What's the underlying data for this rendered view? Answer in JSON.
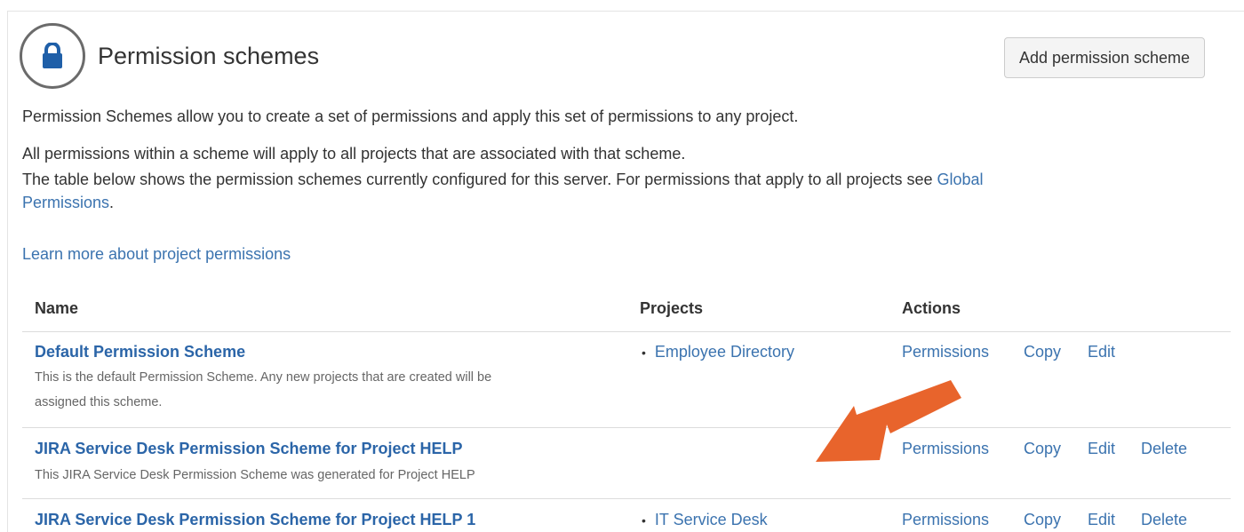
{
  "header": {
    "title": "Permission schemes",
    "add_button": "Add permission scheme"
  },
  "intro": {
    "line1": "Permission Schemes allow you to create a set of permissions and apply this set of permissions to any project.",
    "line2": "All permissions within a scheme will apply to all projects that are associated with that scheme.",
    "line3a": "The table below shows the permission schemes currently configured for this server. For permissions that apply to all projects see ",
    "line3_link1": "Global",
    "line3_link2": "Permissions",
    "line3_end": ".",
    "learn_more": "Learn more about project permissions"
  },
  "table": {
    "headers": {
      "name": "Name",
      "projects": "Projects",
      "actions": "Actions"
    },
    "rows": [
      {
        "name": "Default Permission Scheme",
        "desc1": "This is the default Permission Scheme. Any new projects that are created will be",
        "desc2": "assigned this scheme.",
        "project": "Employee Directory",
        "actions": {
          "permissions": "Permissions",
          "copy": "Copy",
          "edit": "Edit"
        }
      },
      {
        "name": "JIRA Service Desk Permission Scheme for Project HELP",
        "desc1": "This JIRA Service Desk Permission Scheme was generated for Project HELP",
        "actions": {
          "permissions": "Permissions",
          "copy": "Copy",
          "edit": "Edit",
          "delete": "Delete"
        }
      },
      {
        "name": "JIRA Service Desk Permission Scheme for Project HELP 1",
        "project": "IT Service Desk",
        "actions": {
          "permissions": "Permissions",
          "copy": "Copy",
          "edit": "Edit",
          "delete": "Delete"
        }
      }
    ]
  },
  "colors": {
    "link": "#3b73af",
    "arrow": "#e8642c"
  },
  "icons": {
    "header": "lock-icon",
    "annotation": "arrow-annotation"
  }
}
